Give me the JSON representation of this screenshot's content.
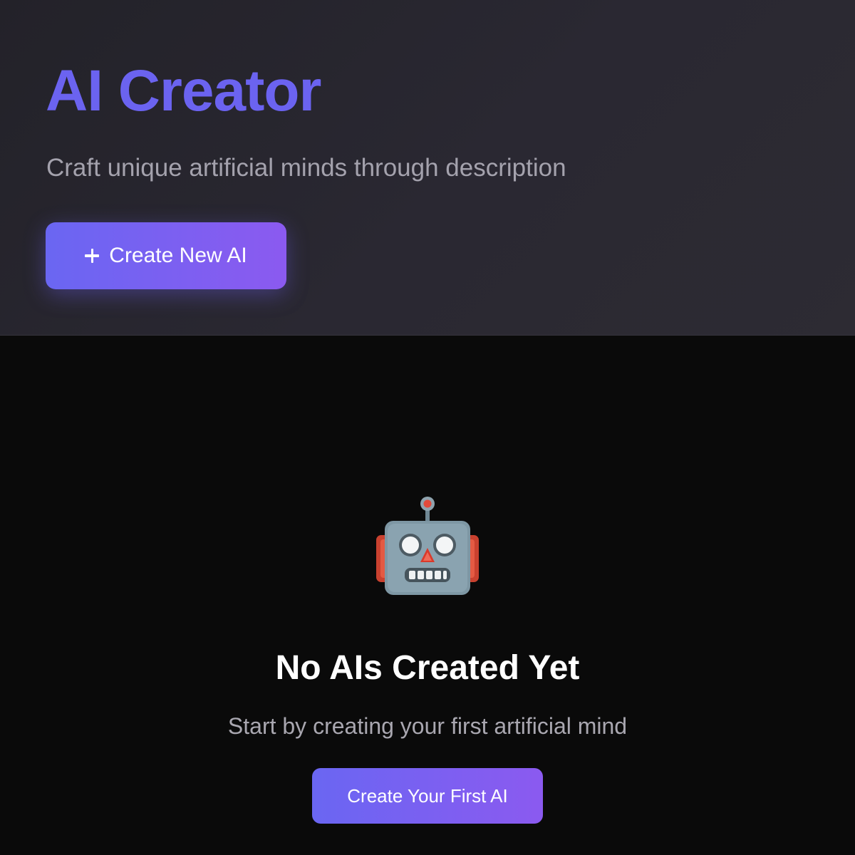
{
  "hero": {
    "title": "AI Creator",
    "subtitle": "Craft unique artificial minds through description",
    "create_button_label": "Create New AI",
    "create_button_icon": "plus-icon"
  },
  "empty_state": {
    "icon": "robot-icon",
    "title": "No AIs Created Yet",
    "subtitle": "Start by creating your first artificial mind",
    "cta_label": "Create Your First AI"
  },
  "colors": {
    "accent_start": "#6a66f2",
    "accent_end": "#8b5af0",
    "title_accent": "#6b63f0",
    "page_background": "#0a0a0a",
    "header_background": "#2a2832"
  }
}
